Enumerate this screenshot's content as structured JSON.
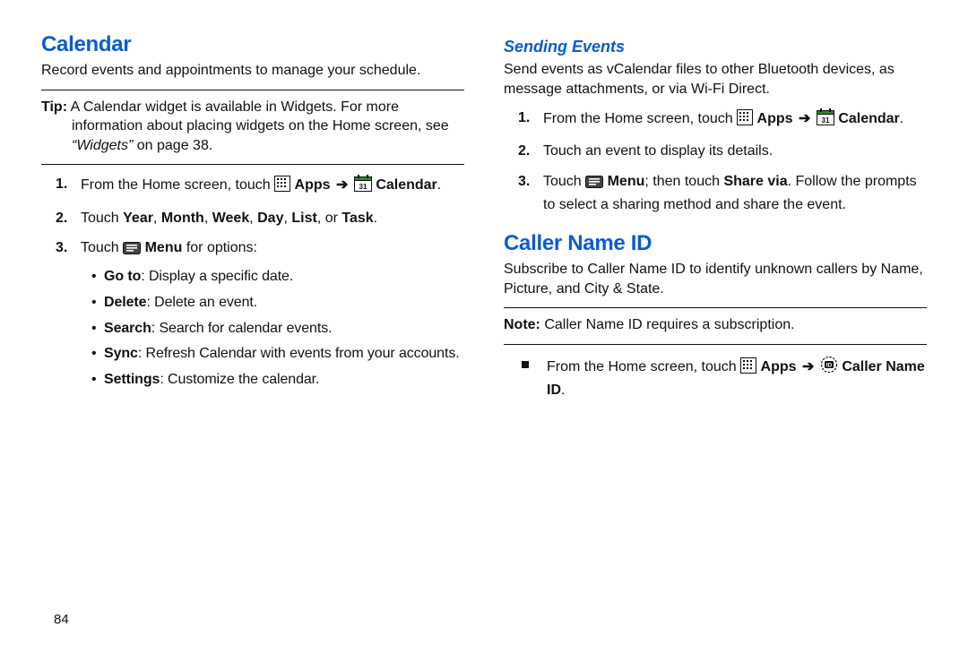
{
  "page_number": "84",
  "left": {
    "heading": "Calendar",
    "intro": "Record events and appointments to manage your schedule.",
    "tip_label": "Tip:",
    "tip_body_1": "A Calendar widget is available in Widgets. For more information about placing widgets on the Home screen, see ",
    "tip_ref": "“Widgets”",
    "tip_body_2": " on page 38.",
    "step1_a": "From the Home screen, touch ",
    "step1_apps": "Apps",
    "step1_cal": "Calendar",
    "step2_a": "Touch ",
    "step2_b": "Year",
    "step2_c": "Month",
    "step2_d": "Week",
    "step2_e": "Day",
    "step2_f": "List",
    "step2_g": "Task",
    "step3_a": "Touch ",
    "step3_menu": "Menu",
    "step3_b": " for options:",
    "bullets": {
      "b1_label": "Go to",
      "b1_text": ": Display a specific date.",
      "b2_label": "Delete",
      "b2_text": ": Delete an event.",
      "b3_label": "Search",
      "b3_text": ": Search for calendar events.",
      "b4_label": "Sync",
      "b4_text": ": Refresh Calendar with events from your accounts.",
      "b5_label": "Settings",
      "b5_text": ": Customize the calendar."
    }
  },
  "right": {
    "sub_heading": "Sending Events",
    "intro": "Send events as vCalendar files to other Bluetooth devices, as message attachments, or via Wi-Fi Direct.",
    "step1_a": "From the Home screen, touch ",
    "step1_apps": "Apps",
    "step1_cal": "Calendar",
    "step2": "Touch an event to display its details.",
    "step3_a": "Touch ",
    "step3_menu": "Menu",
    "step3_b": "; then touch ",
    "step3_share": "Share via",
    "step3_c": ". Follow the prompts to select a sharing method and share the event.",
    "heading2": "Caller Name ID",
    "intro2": "Subscribe to Caller Name ID to identify unknown callers by Name, Picture, and City & State.",
    "note_label": "Note:",
    "note_body": "Caller Name ID requires a subscription.",
    "sq_a": "From the Home screen, touch ",
    "sq_apps": "Apps",
    "sq_caller": "Caller Name ID"
  }
}
